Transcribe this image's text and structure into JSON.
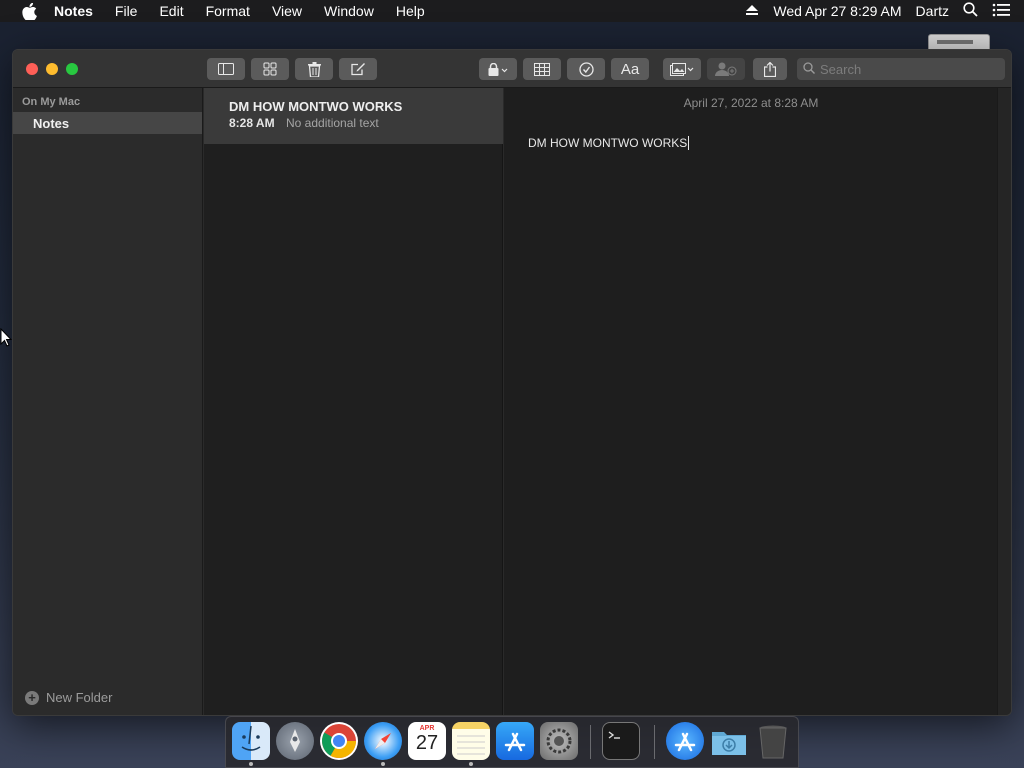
{
  "menubar": {
    "app_name": "Notes",
    "items": [
      "File",
      "Edit",
      "Format",
      "View",
      "Window",
      "Help"
    ],
    "datetime": "Wed Apr 27  8:29 AM",
    "user": "Dartz"
  },
  "toolbar": {
    "search_placeholder": "Search"
  },
  "sidebar": {
    "section_title": "On My Mac",
    "folder": "Notes",
    "new_folder_label": "New Folder"
  },
  "notelist": {
    "notes": [
      {
        "title": "DM HOW MONTWO WORKS",
        "time": "8:28 AM",
        "preview": "No additional text"
      }
    ]
  },
  "editor": {
    "date": "April 27, 2022 at 8:28 AM",
    "body": "DM HOW MONTWO WORKS"
  },
  "dock": {
    "apps": [
      "finder-icon",
      "launchpad-icon",
      "chrome-icon",
      "safari-icon",
      "calendar-icon",
      "notes-icon",
      "app-store-icon",
      "system-preferences-icon",
      "terminal-icon",
      "app-store-folder-icon",
      "downloads-folder-icon",
      "trash-icon"
    ],
    "calendar_month": "APR",
    "calendar_day": "27"
  }
}
